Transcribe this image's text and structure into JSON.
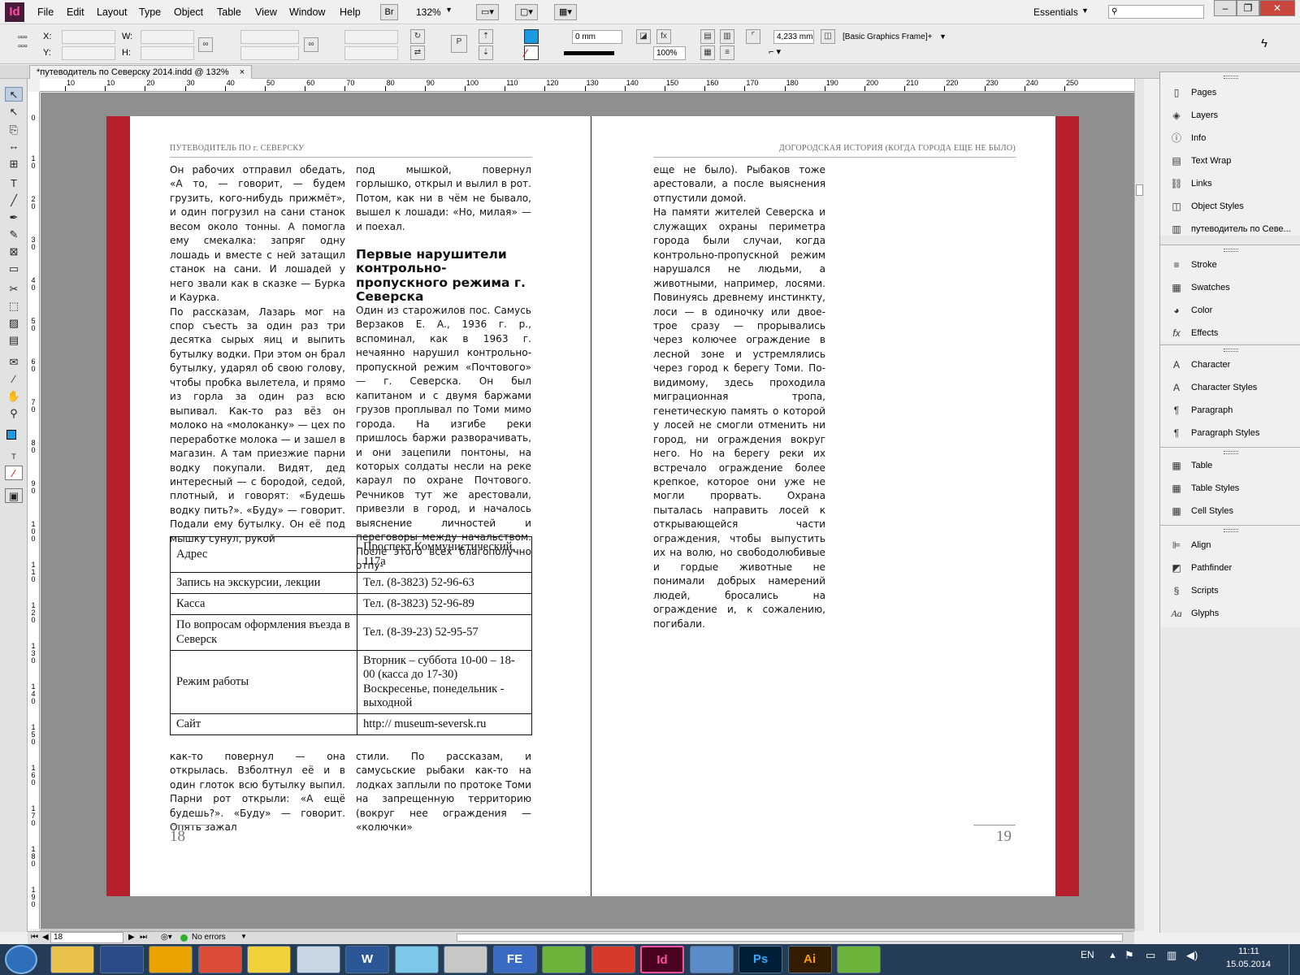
{
  "app": {
    "logo": "Id",
    "menu": [
      "File",
      "Edit",
      "Layout",
      "Type",
      "Object",
      "Table",
      "View",
      "Window",
      "Help"
    ],
    "bridge": "Br",
    "zoom": "132%",
    "workspace": "Essentials",
    "search_placeholder": ""
  },
  "control": {
    "x_label": "X:",
    "y_label": "Y:",
    "w_label": "W:",
    "h_label": "H:",
    "stroke_weight": "0 mm",
    "opacity": "100%",
    "gap": "4,233 mm",
    "object_style": "[Basic Graphics Frame]+",
    "fill_color": "#1b9ae0"
  },
  "doc_tab": {
    "title": "*путеводитель по Северску 2014.indd @ 132%",
    "close": "×"
  },
  "ruler": {
    "h_ticks": [
      "10",
      "10",
      "20",
      "30",
      "40",
      "50",
      "60",
      "70",
      "80",
      "90",
      "100",
      "110",
      "120",
      "130",
      "140",
      "150",
      "160",
      "170",
      "180",
      "190",
      "200",
      "210",
      "220",
      "230",
      "240",
      "250"
    ],
    "v_ticks": [
      "0",
      "1 0",
      "2 0",
      "3 0",
      "4 0",
      "5 0",
      "6 0",
      "7 0",
      "8 0",
      "9 0",
      "1 0 0",
      "1 1 0",
      "1 2 0",
      "1 3 0",
      "1 4 0",
      "1 5 0",
      "1 6 0",
      "1 7 0",
      "1 8 0",
      "1 9 0"
    ]
  },
  "left_page": {
    "running_head": "ПУТЕВОДИТЕЛЬ ПО г. СЕВЕРСКУ",
    "col1_top": "Он рабочих отправил обедать, «А то, — говорит, — будем грузить, кого-нибудь прижмёт», и один погрузил на сани станок весом около тонны. А помогла ему смекалка: запряг одну лошадь и вместе с ней затащил станок на сани. И лошадей у него звали как в сказке — Бурка и Каурка.\n    По рассказам, Лазарь мог на спор съесть за один раз три десятка сырых яиц и выпить бутылку водки. При этом он брал бутылку, ударял об свою голову, чтобы пробка вылетела, и прямо из горла за один раз всю выпивал. Как-то раз вёз он молоко на «молоканку» — цех по переработке молока — и зашел в магазин. А там приезжие парни водку покупали. Видят, дед интересный — с бородой, седой, плотный, и говорят: «Будешь водку пить?». «Буду» — говорит. Подали ему бутылку. Он её под мышку сунул, рукой",
    "col2_top": "под мышкой, повернул горлышко, открыл и вылил в рот. Потом, как ни в чём не бывало, вышел к лошади: «Но, милая» — и поехал.",
    "heading": "Первые нарушители контрольно-пропускного режима г. Северска",
    "col2_mid": "Один из старожилов пос. Самусь Верзаков Е. А., 1936 г. р., вспоминал, как в 1963 г. нечаянно нарушил контрольно-пропускной режим «Почтового» — г. Северска. Он был капитаном и с двумя баржами грузов проплывал по Томи мимо города. На изгибе реки пришлось баржи разворачивать, и они зацепили понтоны, на которых солдаты несли на реке караул по охране Почтового. Речников тут же арестовали, привезли в город, и началось выяснение личностей и переговоры между начальством. После этого всех благополучно отпу-",
    "table": [
      [
        "Адрес",
        "Проспект Коммунистический, 117а"
      ],
      [
        "Запись на экскурсии, лекции",
        "Тел. (8-3823) 52-96-63"
      ],
      [
        "Касса",
        "Тел. (8-3823) 52-96-89"
      ],
      [
        "По вопросам оформления въезда в Северск",
        "Тел. (8-39-23) 52-95-57"
      ],
      [
        "Режим работы",
        "Вторник – суббота 10-00 – 18-00 (касса до 17-30) Воскресенье, понедельник - выходной"
      ],
      [
        "Сайт",
        "http:// museum-seversk.ru"
      ]
    ],
    "col1_bottom": "как-то повернул — она открылась. Взболтнул её и в один глоток всю бутылку выпил. Парни рот открыли: «А ещё будешь?». «Буду» — говорит. Опять зажал",
    "col2_bottom": "стили. По рассказам, и самусьские рыбаки как-то на лодках заплыли по протоке Томи на запрещенную территорию (вокруг нее ограждения — «колючки»",
    "folio": "18"
  },
  "right_page": {
    "running_head": "ДОГОРОДСКАЯ ИСТОРИЯ (КОГДА ГОРОДА ЕЩЕ НЕ БЫЛО)",
    "col1": "еще не было). Рыбаков тоже арестовали, а после выяснения отпустили домой.\n    На памяти жителей Северска и служащих охраны периметра города были случаи, когда контрольно-пропускной режим нарушался не людьми, а животными, например, лосями. Повинуясь древнему инстинкту, лоси — в одиночку или двое-трое сразу — прорывались через колючее ограждение в лесной зоне и устремлялись через город к берегу Томи. По-видимому, здесь проходила миграционная тропа, генетическую память о которой у лосей не смогли отменить ни город, ни ограждения вокруг него. Но на берегу реки их встречало ограждение более крепкое, которое они уже не могли прорвать. Охрана пыталась направить лосей к открывающейся части ограждения, чтобы выпустить их на волю, но свободолюбивые и гордые животные не понимали добрых намерений людей, бросались на ограждение и, к сожалению, погибали.",
    "folio": "19"
  },
  "panels": {
    "g1": [
      "Pages",
      "Layers",
      "Info",
      "Text Wrap",
      "Links",
      "Object Styles",
      "путеводитель по Севе..."
    ],
    "g2": [
      "Stroke",
      "Swatches",
      "Color",
      "Effects"
    ],
    "g3": [
      "Character",
      "Character Styles",
      "Paragraph",
      "Paragraph Styles"
    ],
    "g4": [
      "Table",
      "Table Styles",
      "Cell Styles"
    ],
    "g5": [
      "Align",
      "Pathfinder",
      "Scripts",
      "Glyphs"
    ]
  },
  "status": {
    "page": "18",
    "errors": "No errors"
  },
  "taskbar": {
    "apps": [
      "",
      "",
      "",
      "",
      "",
      "",
      "W",
      "",
      "",
      "FE",
      "",
      "",
      "Id",
      "",
      "Ps",
      "Ai",
      ""
    ],
    "lang": "EN",
    "time": "11:11",
    "date": "15.05.2014"
  }
}
